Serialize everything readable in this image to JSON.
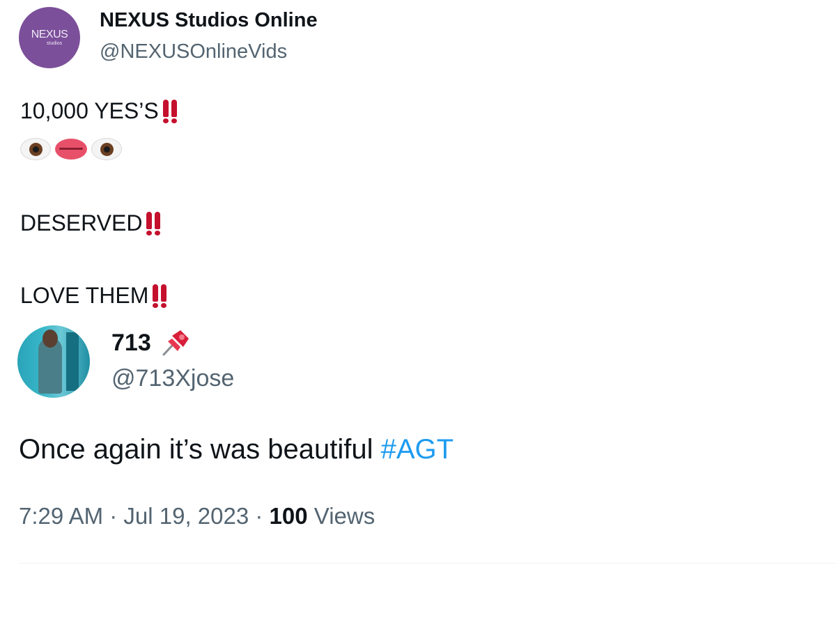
{
  "original_tweet": {
    "avatar": {
      "logo_text": "NEXUS",
      "logo_subtext": "studios",
      "color": "#7b4f9a"
    },
    "display_name": "NEXUS Studios Online",
    "handle": "@NEXUSOnlineVids",
    "lines": [
      {
        "text": "10,000 YES’S",
        "emoji": "double-exclamation-mark"
      },
      {
        "emoji_sequence": [
          "eye-icon",
          "lips-icon",
          "eye-icon"
        ]
      },
      {
        "text": "DESERVED",
        "emoji": "double-exclamation-mark"
      },
      {
        "text": "LOVE THEM",
        "emoji": "double-exclamation-mark"
      }
    ]
  },
  "reply_tweet": {
    "display_name": "713",
    "name_emoji": "pushpin-icon",
    "handle": "@713Xjose",
    "text": "Once again it’s was beautiful ",
    "hashtag": "#AGT",
    "hashtag_color": "#1d9bf0"
  },
  "meta": {
    "time": "7:29 AM",
    "separator": " · ",
    "date": "Jul 19, 2023",
    "views_count": "100",
    "views_label": " Views"
  },
  "colors": {
    "text": "#0f1419",
    "secondary": "#536471",
    "exclamation": "#c4102d"
  }
}
